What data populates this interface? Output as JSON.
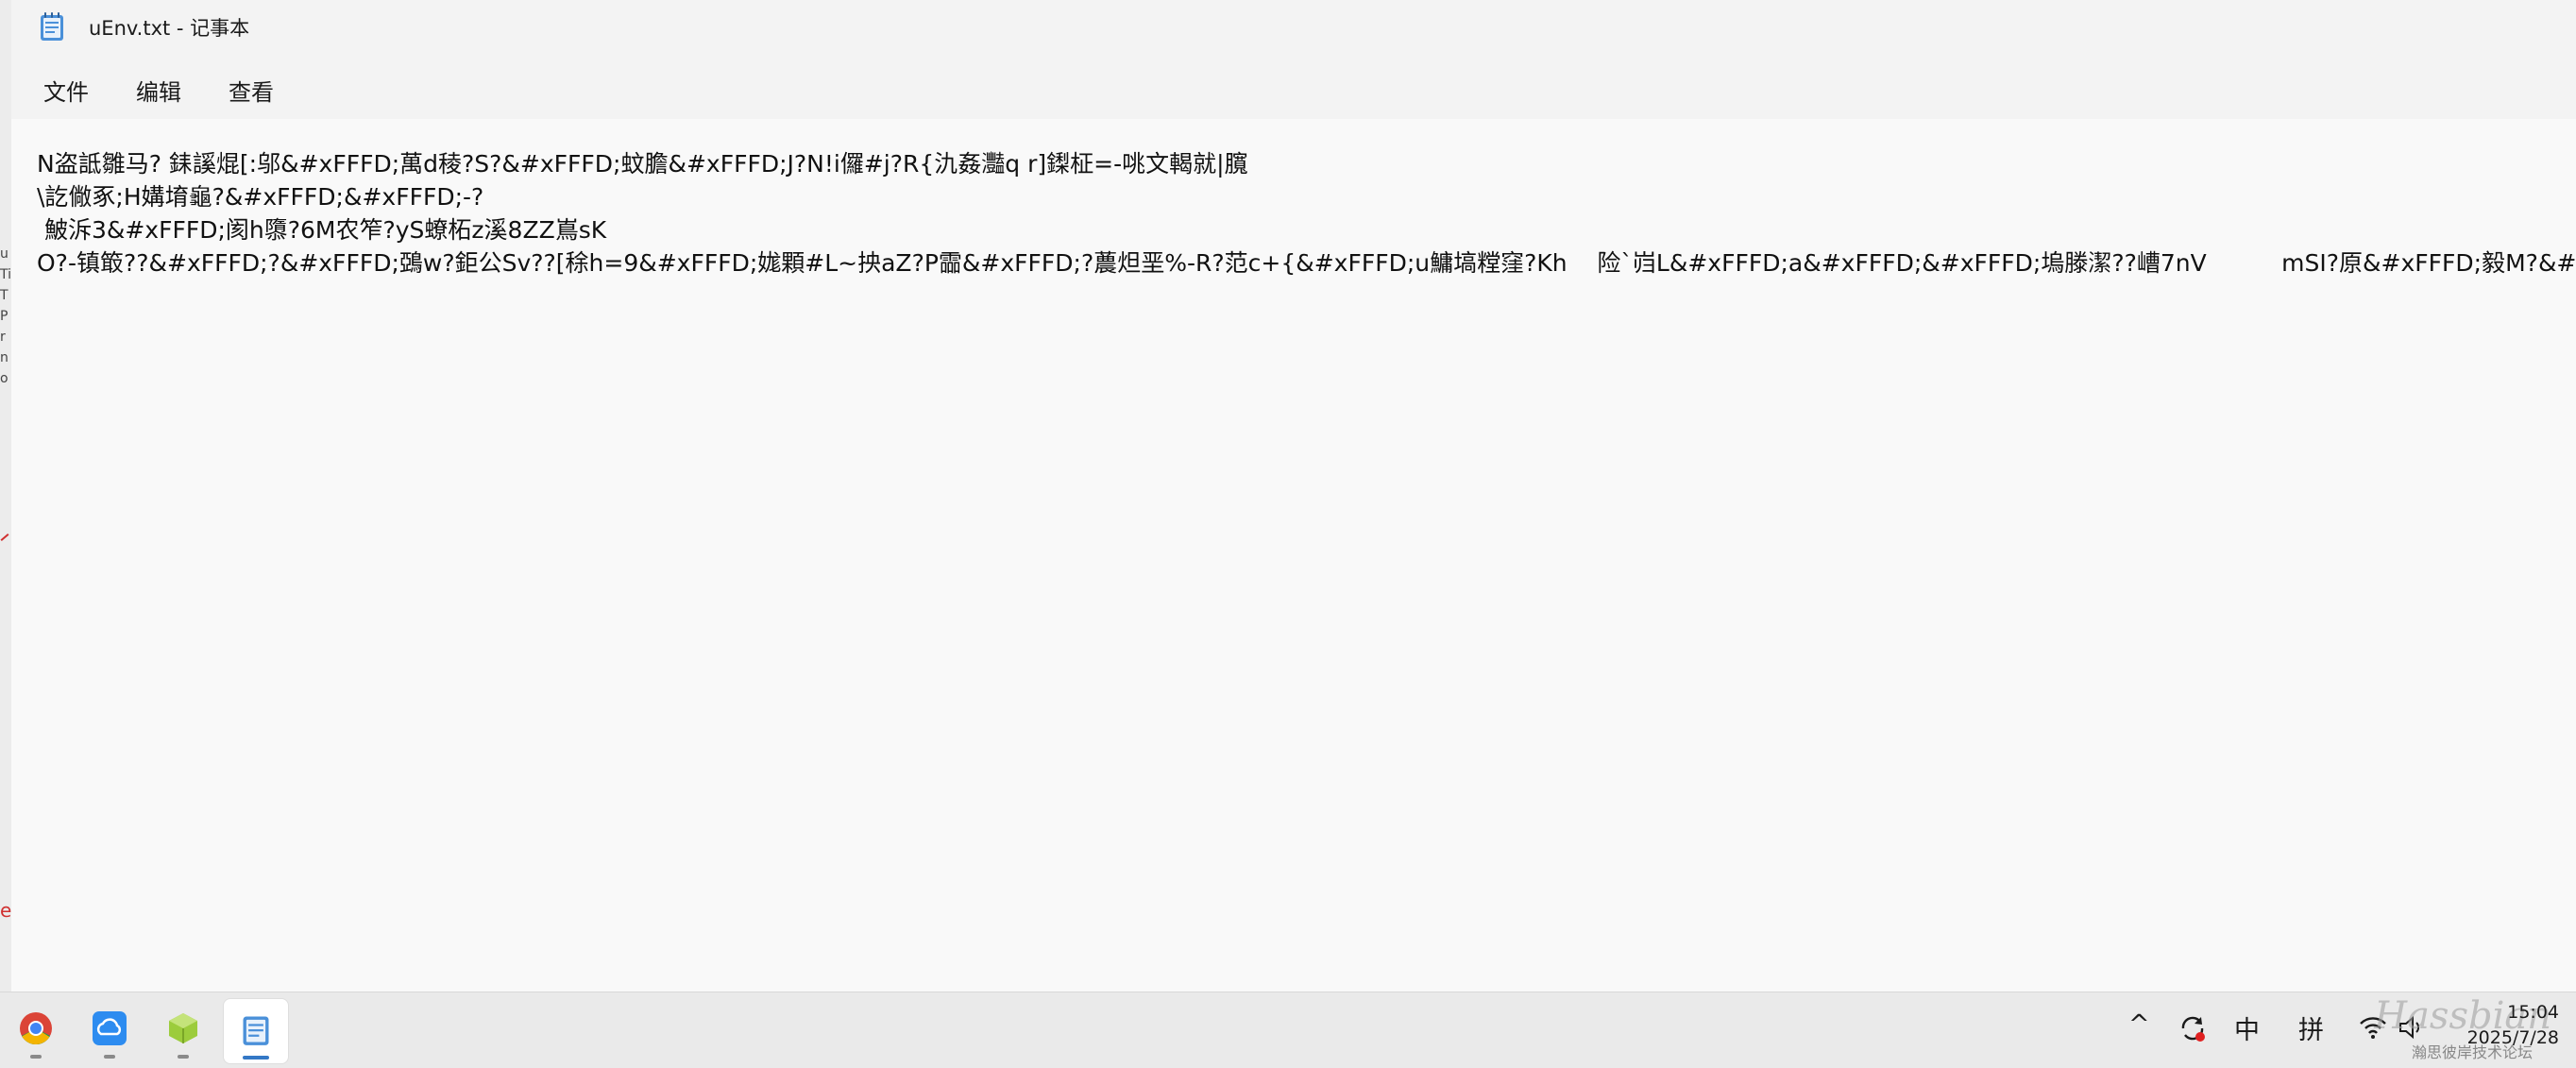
{
  "window": {
    "title": "uEnv.txt - 记事本",
    "menu": [
      "文件",
      "编辑",
      "查看"
    ]
  },
  "document": {
    "lines": [
      "N盗詆雛马? 銇謑焜[:邬&#xFFFD;萬d稜?S?&#xFFFD;蚊膽&#xFFFD;J?N!i儸#j?R{氿姦灩q r]鏫柾=-咷文輵就|臗",
      "\\訖僘豖;H媾堉龜?&#xFFFD;&#xFFFD;-?",
      " 鮍泝3&#xFFFD;阂h隳?6M农笮?yS蟟柘z溪8ZZ嶌sK",
      "O?-镇箃??&#xFFFD;?&#xFFFD;鵶w?鉅公Sv??[稌h=9&#xFFFD;娏顆#L~抰aZ?P霝&#xFFFD;?蕽炟垩%-R?范c+{&#xFFFD;u鱅塙糛窪?Kh    险`岿L&#xFFFD;a&#xFFFD;&#xFFFD;塢滕潔??嶆7nV          mSI?原&#xFFFD;毅M?&#xFFFD;m摵繾冗Y}鎬梲沩驪f&#xFFFD;秀4CU咟D價鴿?筌F?&#xFFFD;严婸&#xFFFD;輸湏炌渓Z掼貽KG{祇"
    ]
  },
  "taskbar": {
    "apps": [
      {
        "name": "chrome-icon",
        "active": false
      },
      {
        "name": "cloud-app-icon",
        "active": false
      },
      {
        "name": "box-app-icon",
        "active": false
      },
      {
        "name": "notepad-icon",
        "active": true
      }
    ],
    "tray": {
      "chevron": "^",
      "ime_mode": "中",
      "ime_input": "拼",
      "time": "15:04",
      "date": "2025/7/28"
    },
    "watermark": "Hassbian",
    "watermark_sub": "瀚思彼岸技术论坛"
  }
}
